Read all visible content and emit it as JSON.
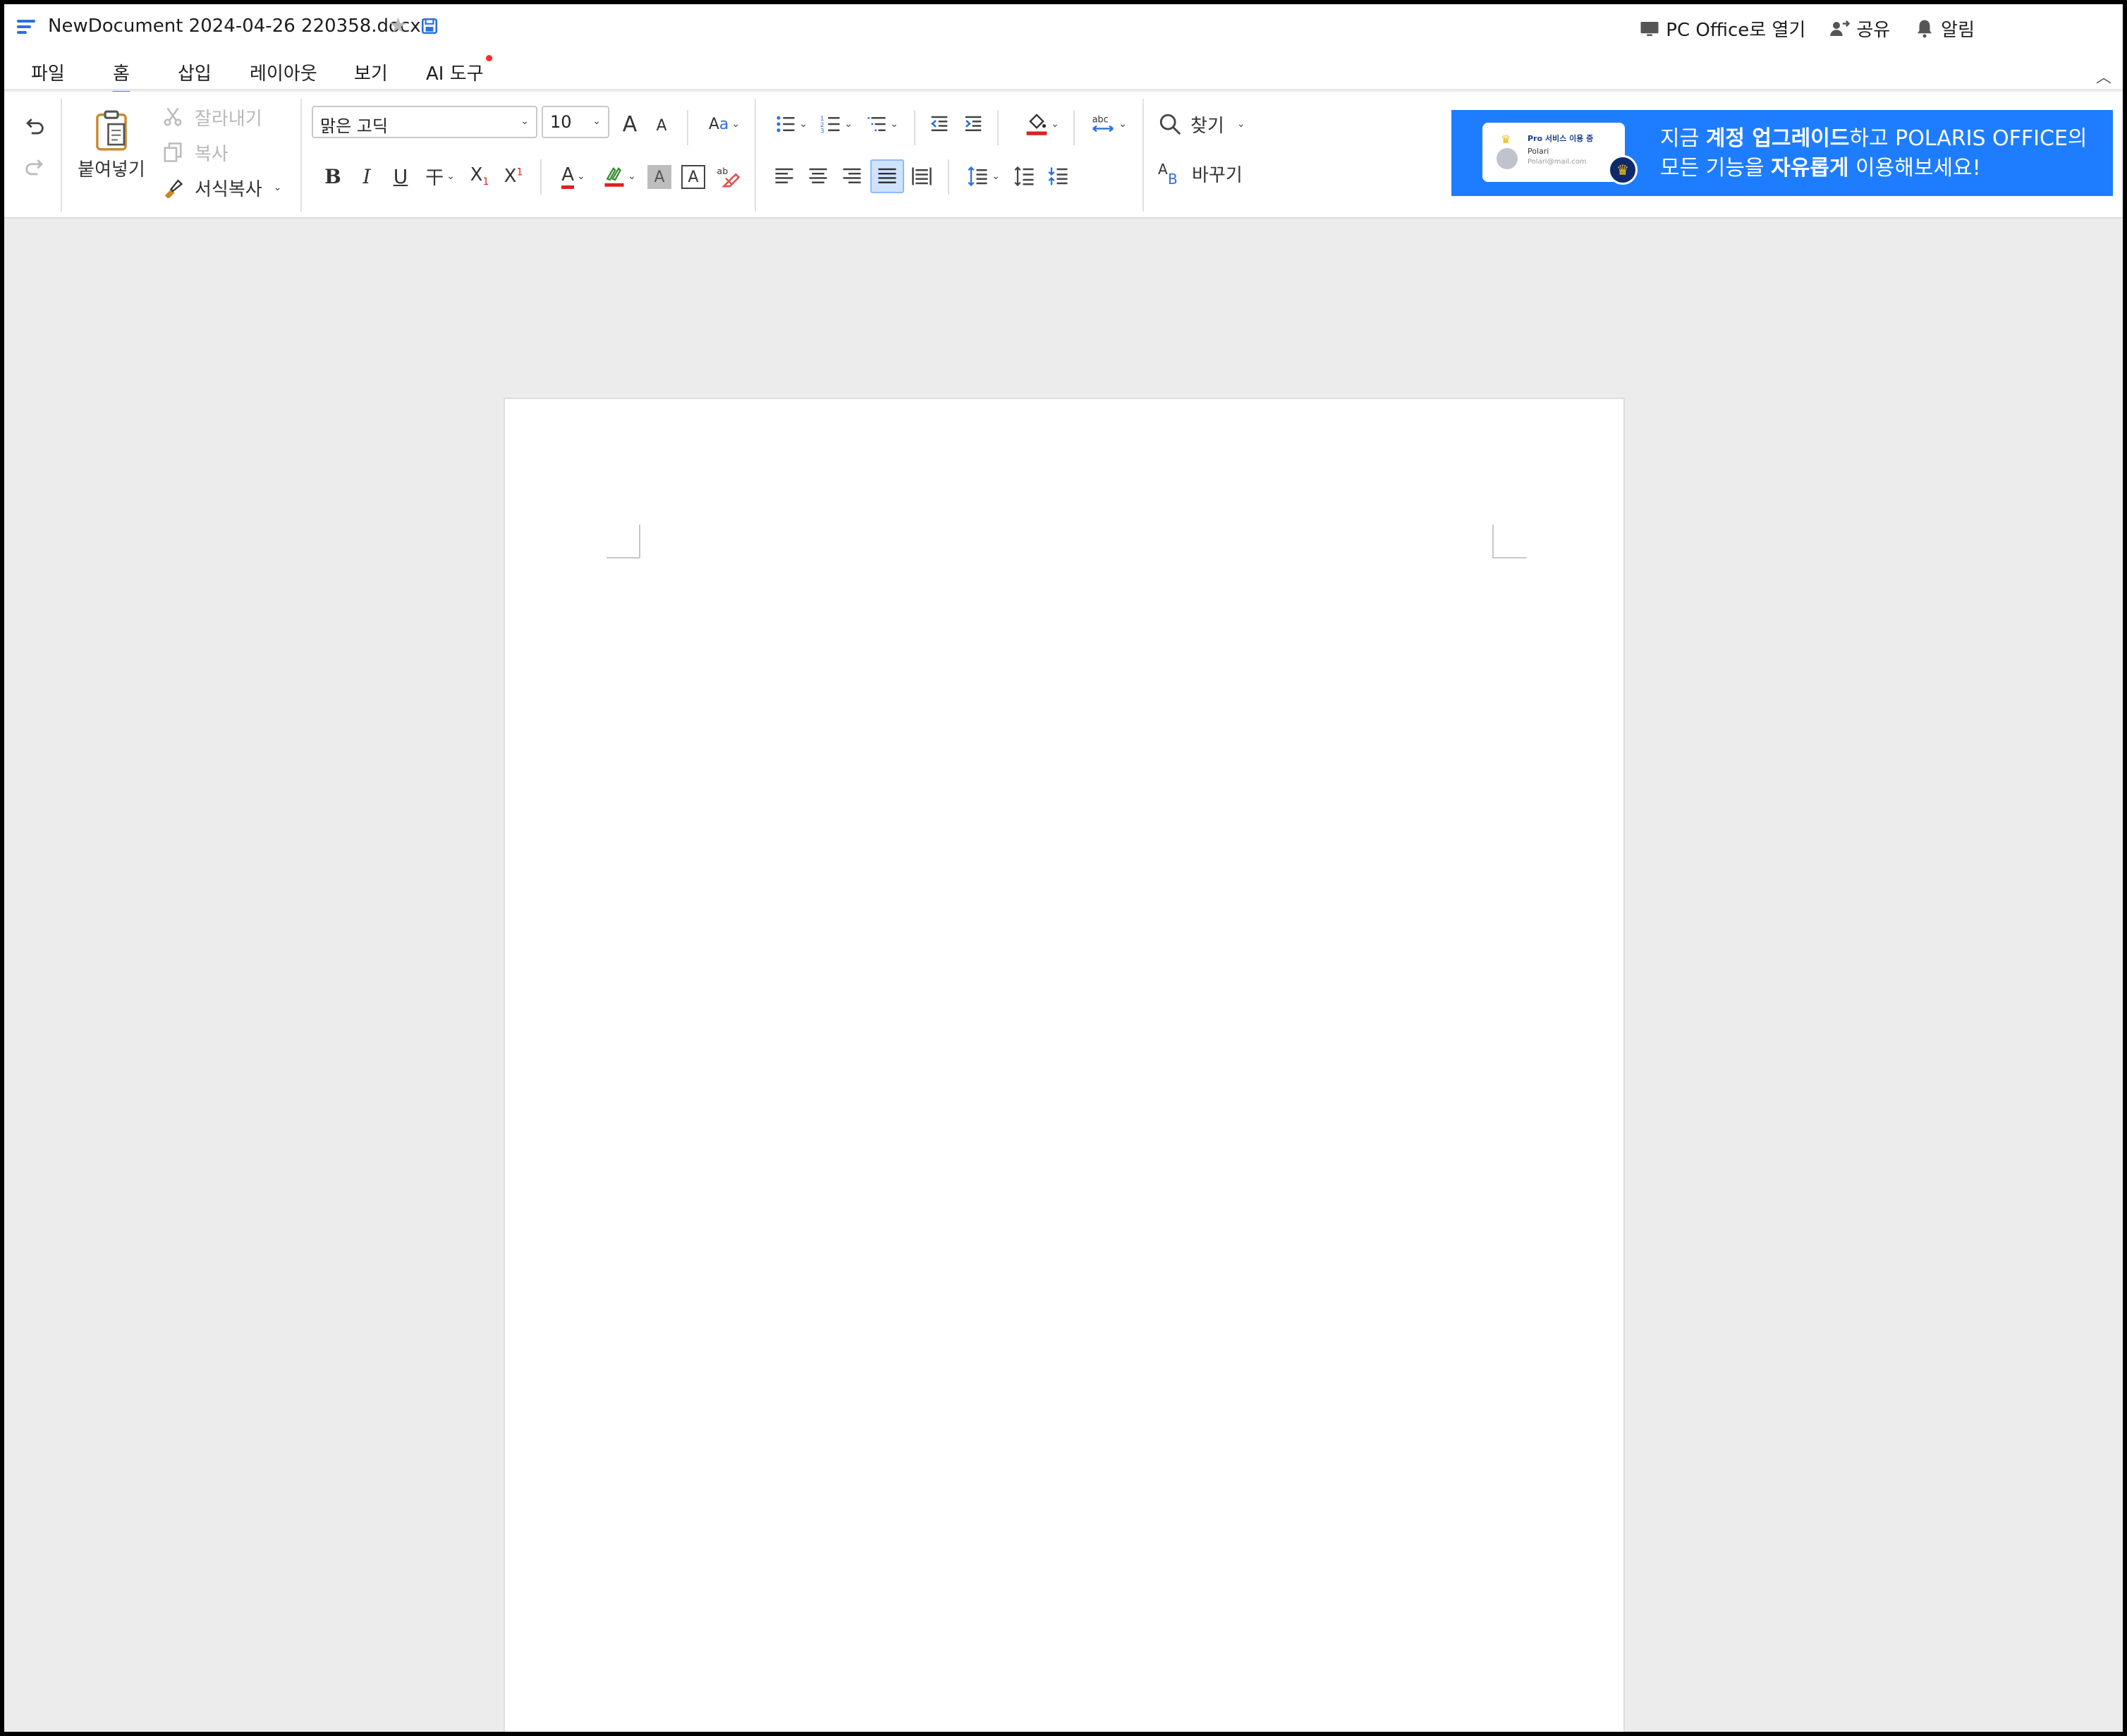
{
  "app": {
    "document_title": "NewDocument 2024-04-26 220358.docx",
    "top_actions": {
      "open_pc": "PC Office로 열기",
      "share": "공유",
      "notify": "알림"
    }
  },
  "tabs": [
    {
      "label": "파일"
    },
    {
      "label": "홈"
    },
    {
      "label": "삽입"
    },
    {
      "label": "레이아웃"
    },
    {
      "label": "보기"
    },
    {
      "label": "AI 도구"
    }
  ],
  "ribbon": {
    "paste": "붙여넣기",
    "cut": "잘라내기",
    "copy": "복사",
    "format_painter": "서식복사",
    "font_name": "맑은 고딕",
    "font_size": "10",
    "find": "찾기",
    "replace": "바꾸기",
    "grow_font": "A",
    "shrink_font": "A",
    "case_a": "A",
    "case_b": "a",
    "bold": "B",
    "italic": "I",
    "underline": "U",
    "strike": "干",
    "subscript": "X",
    "subscript_index": "1",
    "superscript": "X",
    "superscript_index": "1",
    "font_color": "A",
    "char_shade": "A",
    "char_border": "A",
    "spell": "abc",
    "replace_a": "A",
    "replace_b": "B"
  },
  "banner": {
    "card_title": "Pro 서비스 이용 중",
    "card_name": "Polari",
    "card_mail": "Polari@mail.com",
    "line1_a": "지금 ",
    "line1_b": "계정 업그레이드",
    "line1_c": "하고 POLARIS OFFICE의",
    "line2_a": "모든 기능을 ",
    "line2_b": "자유롭게",
    "line2_c": " 이용해보세요!"
  },
  "colors": {
    "accent": "#1e7dff",
    "tab_indicator": "#2a86ff",
    "font_color_bar": "#e02020",
    "canvas_bg": "#ececec"
  }
}
